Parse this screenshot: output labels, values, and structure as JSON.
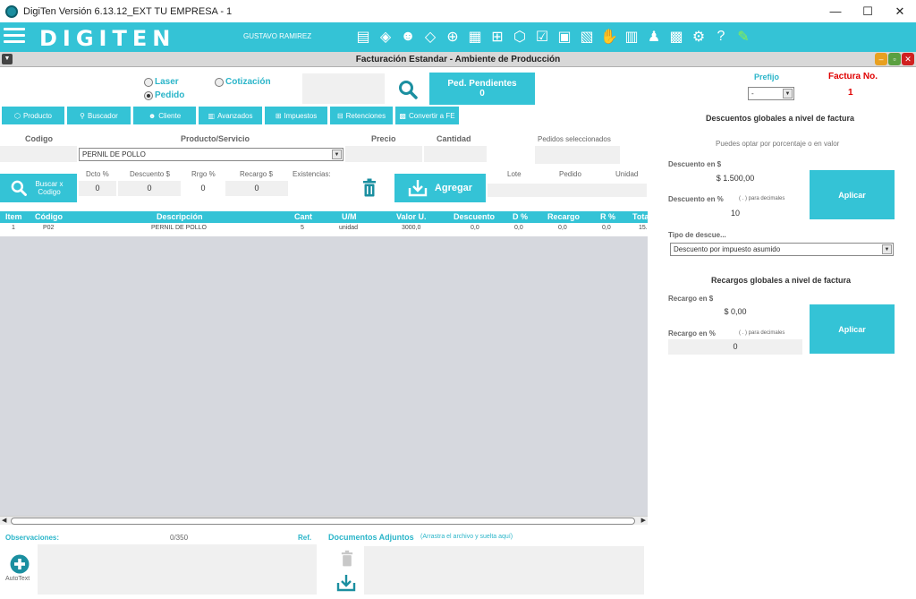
{
  "window": {
    "title": "DigiTen Versión 6.13.12_EXT TU EMPRESA - 1",
    "minimize": "—",
    "maximize": "☐",
    "close": "✕"
  },
  "toolbar": {
    "brand": "DIGITEN",
    "user": "GUSTAVO RAMIREZ",
    "icons": [
      "invoice-icon",
      "tag-icon",
      "user-add-icon",
      "label-icon",
      "cart-add-icon",
      "document-icon",
      "cart-icon",
      "box-icon",
      "checklist-icon",
      "doc-add-icon",
      "doc-plus-icon",
      "handshake-icon",
      "chart-icon",
      "user-chart-icon",
      "image-icon",
      "gear-icon",
      "help-icon",
      "pen-icon"
    ]
  },
  "form": {
    "subtitle": "Facturación Estandar -  Ambiente de Producción",
    "mode": {
      "laser": "Laser",
      "pedido": "Pedido",
      "cotizacion": "Cotización",
      "selected": "Pedido"
    },
    "ped_pendientes": {
      "label": "Ped. Pendientes",
      "count": "0"
    },
    "tabs": [
      "Producto",
      "Buscador",
      "Cliente",
      "Avanzados",
      "Impuestos",
      "Retenciones",
      "Convertir a FE"
    ],
    "labels": {
      "codigo": "Codigo",
      "producto": "Producto/Servicio",
      "precio": "Precio",
      "cantidad": "Cantidad",
      "pedidos_sel": "Pedidos seleccionados",
      "dcto_pct": "Dcto %",
      "descuento": "Descuento $",
      "rrgo_pct": "Rrgo %",
      "recargo": "Recargo $",
      "existencias": "Existencias:",
      "lote": "Lote",
      "pedido": "Pedido",
      "unidad": "Unidad"
    },
    "producto_value": "PERNIL DE POLLO",
    "values": {
      "dcto": "0",
      "descuento": "0",
      "rrgo": "0",
      "recargo": "0"
    },
    "buscar_codigo": "Buscar x Codigo",
    "agregar": "Agregar"
  },
  "grid": {
    "columns": [
      "Item",
      "Código",
      "Descripción",
      "Cant",
      "U/M",
      "Valor U.",
      "Descuento",
      "D %",
      "Recargo",
      "R %",
      "Tota"
    ],
    "rows": [
      [
        "1",
        "P02",
        "PERNIL DE POLLO",
        "5",
        "unidad",
        "3000,0",
        "0,0",
        "0,0",
        "0,0",
        "0,0",
        "15."
      ]
    ]
  },
  "footer": {
    "observaciones": "Observaciones:",
    "counter": "0/350",
    "ref": "Ref.",
    "documentos": "Documentos Adjuntos",
    "drag_hint": "(Arrastra el archivo y suelta aquí)",
    "autotext": "AutoText"
  },
  "right": {
    "prefijo_label": "Prefijo",
    "prefijo_value": "-",
    "factura_label": "Factura No.",
    "factura_value": "1",
    "desc_title": "Descuentos globales a nivel de factura",
    "desc_hint": "Puedes optar por  porcentaje o en valor",
    "desc_val_label": "Descuento en $",
    "desc_val": "$ 1.500,00",
    "desc_pct_label": "Descuento en %",
    "desc_pct_hint": "( . ) para decimales",
    "desc_pct": "10",
    "aplicar": "Aplicar",
    "tipo_label": "Tipo de descue...",
    "tipo_value": "Descuento por impuesto asumido",
    "rec_title": "Recargos globales a nivel de factura",
    "rec_val_label": "Recargo en $",
    "rec_val": "$ 0,00",
    "rec_pct_label": "Recargo en %",
    "rec_pct_hint": "( . ) para decimales",
    "rec_pct": "0"
  }
}
